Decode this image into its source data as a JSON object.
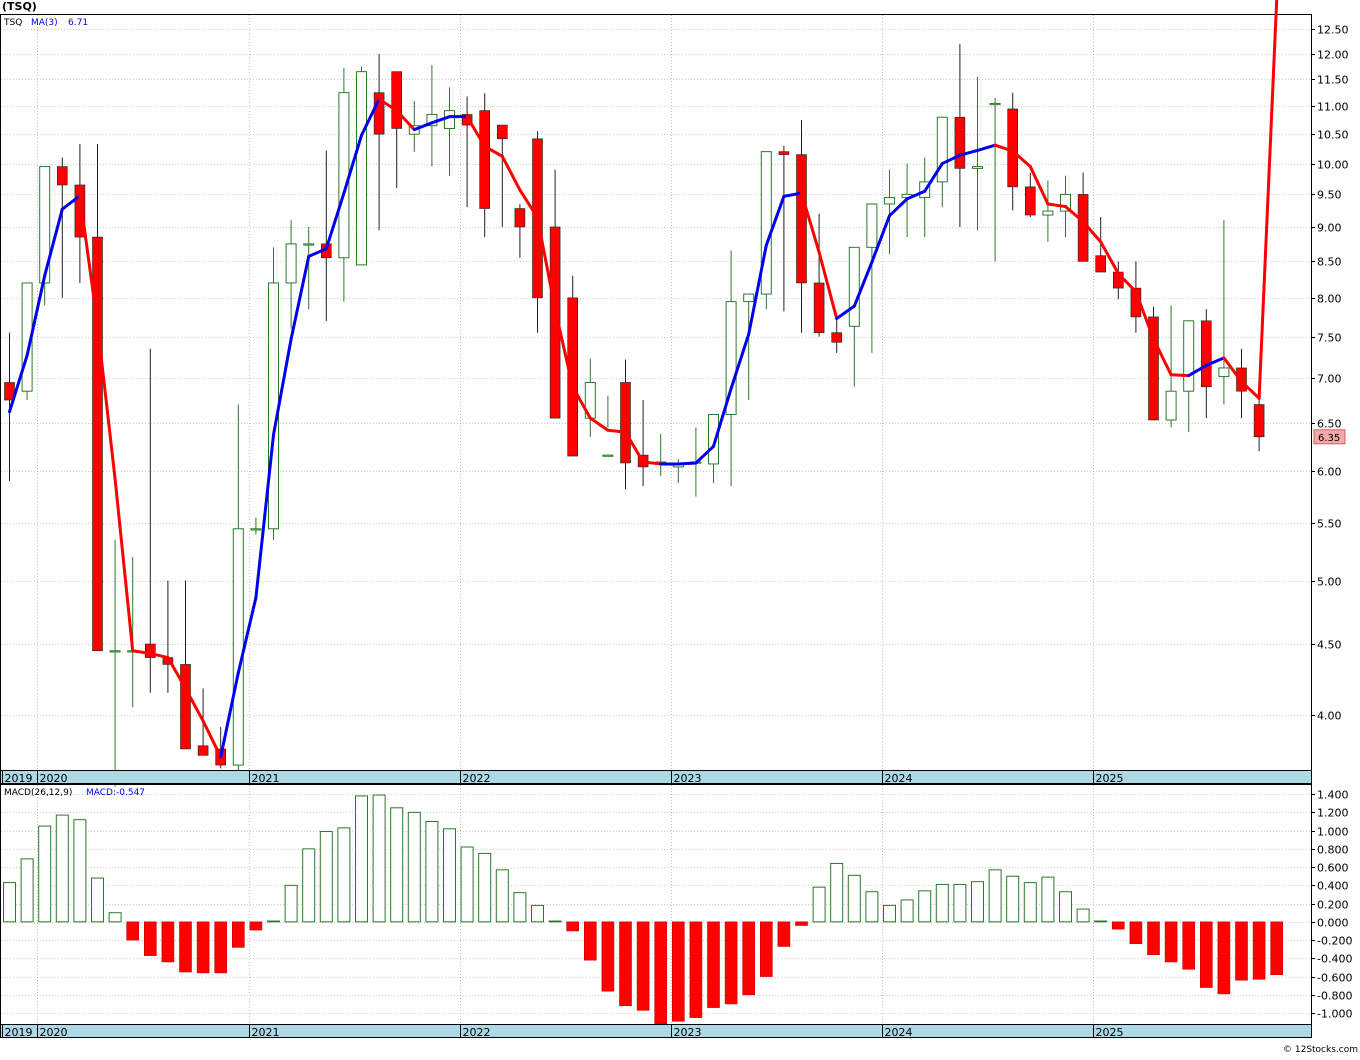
{
  "header": {
    "ticker": "(TSQ)",
    "ma_label": "TSQ",
    "ma_name": "MA(3)",
    "ma_value": "6.71",
    "macd_name": "MACD(26,12,9)",
    "macd_value": "MACD:-0.547",
    "last_price_label": "6.35",
    "watermark": "© 12Stocks.com"
  },
  "colors": {
    "up_candle": "#2a7a2a",
    "down_candle": "#ff0000",
    "ma_up": "#0000ee",
    "ma_down": "#ff0000",
    "axis_band": "#add8e6",
    "grid": "#999999"
  },
  "chart_data": [
    {
      "type": "candlestick",
      "interval": "monthly",
      "title": "(TSQ)",
      "scale": "log",
      "ylim": [
        3.65,
        12.8
      ],
      "y_ticks": [
        4.0,
        4.5,
        5.0,
        5.5,
        6.0,
        6.5,
        7.0,
        7.5,
        8.0,
        8.5,
        9.0,
        9.5,
        10.0,
        10.5,
        11.0,
        11.5,
        12.0,
        12.5
      ],
      "y_tick_labels": [
        "4.00",
        "4.50",
        "5.00",
        "5.50",
        "6.00",
        "6.50",
        "7.00",
        "7.50",
        "8.00",
        "8.50",
        "9.00",
        "9.50",
        "10.00",
        "10.50",
        "11.00",
        "11.50",
        "12.00",
        "12.50"
      ],
      "x_axis_labels": [
        "2019",
        "2020",
        "2021",
        "2022",
        "2023",
        "2024",
        "2025"
      ],
      "x_label_months": [
        "2019-11",
        "2020-01",
        "2021-01",
        "2022-01",
        "2023-01",
        "2024-01",
        "2025-01"
      ],
      "months": [
        "2019-11",
        "2019-12",
        "2020-01",
        "2020-02",
        "2020-03",
        "2020-04",
        "2020-05",
        "2020-06",
        "2020-07",
        "2020-08",
        "2020-09",
        "2020-10",
        "2020-11",
        "2020-12",
        "2021-01",
        "2021-02",
        "2021-03",
        "2021-04",
        "2021-05",
        "2021-06",
        "2021-07",
        "2021-08",
        "2021-09",
        "2021-10",
        "2021-11",
        "2021-12",
        "2022-01",
        "2022-02",
        "2022-03",
        "2022-04",
        "2022-05",
        "2022-06",
        "2022-07",
        "2022-08",
        "2022-09",
        "2022-10",
        "2022-11",
        "2022-12",
        "2023-01",
        "2023-02",
        "2023-03",
        "2023-04",
        "2023-05",
        "2023-06",
        "2023-07",
        "2023-08",
        "2023-09",
        "2023-10",
        "2023-11",
        "2023-12",
        "2024-01",
        "2024-02",
        "2024-03",
        "2024-04",
        "2024-05",
        "2024-06",
        "2024-07",
        "2024-08",
        "2024-09",
        "2024-10",
        "2024-11",
        "2024-12",
        "2025-01",
        "2025-02",
        "2025-03",
        "2025-04",
        "2025-05",
        "2025-06",
        "2025-07",
        "2025-08",
        "2025-09",
        "2025-10",
        "2025-11"
      ],
      "open": [
        6.95,
        6.85,
        8.2,
        9.95,
        9.65,
        8.85,
        4.45,
        4.45,
        4.5,
        4.4,
        4.35,
        3.8,
        3.78,
        3.68,
        5.45,
        5.45,
        8.2,
        8.75,
        8.75,
        8.55,
        8.45,
        11.25,
        11.65,
        10.5,
        10.65,
        10.6,
        10.85,
        10.92,
        10.66,
        9.28,
        10.42,
        9.0,
        8.0,
        6.55,
        6.15,
        6.95,
        6.16,
        6.08,
        6.04,
        6.09,
        6.07,
        6.59,
        7.95,
        8.05,
        10.2,
        10.15,
        8.2,
        7.55,
        7.63,
        8.7,
        9.35,
        9.45,
        9.45,
        9.7,
        10.8,
        9.92,
        11.05,
        10.95,
        9.62,
        9.18,
        9.24,
        9.5,
        8.58,
        8.35,
        8.13,
        7.75,
        6.53,
        6.85,
        7.7,
        7.02,
        7.12,
        6.7
      ],
      "high": [
        7.55,
        7.35,
        8.6,
        10.1,
        10.33,
        10.33,
        5.35,
        5.2,
        7.35,
        5.0,
        5.0,
        4.18,
        3.92,
        6.7,
        5.55,
        8.7,
        9.1,
        9.0,
        10.22,
        11.72,
        11.75,
        12.0,
        11.1,
        11.1,
        11.78,
        11.35,
        11.18,
        11.24,
        10.65,
        9.35,
        10.55,
        9.9,
        8.3,
        7.23,
        6.8,
        7.22,
        6.75,
        6.38,
        6.12,
        6.45,
        6.4,
        8.65,
        8.05,
        8.5,
        10.3,
        10.75,
        9.2,
        7.75,
        7.85,
        9.15,
        9.9,
        10.0,
        10.1,
        10.5,
        12.2,
        11.55,
        11.15,
        11.25,
        9.85,
        9.72,
        9.8,
        9.85,
        9.15,
        8.5,
        8.5,
        7.88,
        7.9,
        7.2,
        7.85,
        9.1,
        7.35,
        6.85
      ],
      "low": [
        5.9,
        6.75,
        7.9,
        8.0,
        8.2,
        4.45,
        3.55,
        4.05,
        4.15,
        4.15,
        3.85,
        3.78,
        3.66,
        3.65,
        5.4,
        5.35,
        7.6,
        7.85,
        7.7,
        7.95,
        8.95,
        8.95,
        9.6,
        10.2,
        9.95,
        9.8,
        9.3,
        8.85,
        9.0,
        8.55,
        7.55,
        6.55,
        6.25,
        6.35,
        6.45,
        5.82,
        5.85,
        5.95,
        5.88,
        5.75,
        5.88,
        5.85,
        6.75,
        7.85,
        7.82,
        7.55,
        7.5,
        7.3,
        6.9,
        7.3,
        8.6,
        8.85,
        8.85,
        9.3,
        9.0,
        8.95,
        8.5,
        9.25,
        9.15,
        8.78,
        8.85,
        8.7,
        8.35,
        7.98,
        7.55,
        6.95,
        6.45,
        6.4,
        6.55,
        6.7,
        6.55,
        6.2
      ],
      "close": [
        6.75,
        8.2,
        9.95,
        9.65,
        8.85,
        4.45,
        4.45,
        4.45,
        4.4,
        4.35,
        3.78,
        3.74,
        3.68,
        5.45,
        5.45,
        8.2,
        8.75,
        8.75,
        8.55,
        11.25,
        11.65,
        10.5,
        10.6,
        10.65,
        10.85,
        10.92,
        10.66,
        9.28,
        10.42,
        9.0,
        8.0,
        6.55,
        6.15,
        6.95,
        6.16,
        6.08,
        6.04,
        6.09,
        6.07,
        6.09,
        6.59,
        7.95,
        8.05,
        10.2,
        10.15,
        8.2,
        7.55,
        7.43,
        8.7,
        9.35,
        9.45,
        9.5,
        9.7,
        10.8,
        9.92,
        9.95,
        11.05,
        9.62,
        9.18,
        9.24,
        9.5,
        8.5,
        8.35,
        8.13,
        7.75,
        6.53,
        6.85,
        7.7,
        6.9,
        7.12,
        6.85,
        6.35
      ],
      "ma3": [
        6.62,
        7.27,
        8.3,
        9.27,
        9.48,
        7.65,
        5.92,
        4.45,
        4.43,
        4.4,
        4.18,
        3.96,
        3.73,
        4.29,
        4.86,
        6.37,
        7.47,
        8.57,
        8.68,
        9.52,
        10.48,
        11.13,
        10.92,
        10.58,
        10.7,
        10.81,
        10.81,
        10.29,
        10.12,
        9.57,
        9.14,
        7.85,
        6.9,
        6.55,
        6.42,
        6.4,
        6.09,
        6.07,
        6.07,
        6.08,
        6.25,
        6.88,
        7.53,
        8.73,
        9.47,
        9.52,
        8.63,
        7.73,
        7.89,
        8.49,
        9.17,
        9.43,
        9.55,
        10.0,
        10.14,
        10.22,
        10.31,
        10.21,
        9.95,
        9.35,
        9.31,
        9.08,
        8.78,
        8.33,
        8.08,
        7.47,
        7.04,
        7.03,
        7.15,
        7.24,
        6.96,
        6.77
      ],
      "last": 6.35
    },
    {
      "type": "bar",
      "title": "MACD(26,12,9)",
      "ylim": [
        -1.12,
        1.5
      ],
      "y_ticks": [
        -1.0,
        -0.8,
        -0.6,
        -0.4,
        -0.2,
        0.0,
        0.2,
        0.4,
        0.6,
        0.8,
        1.0,
        1.2,
        1.4
      ],
      "y_tick_labels": [
        "-1.000",
        "-0.800",
        "-0.600",
        "-0.400",
        "-0.200",
        "0.000",
        "0.200",
        "0.400",
        "0.600",
        "0.800",
        "1.000",
        "1.200",
        "1.400"
      ],
      "x_axis_labels": [
        "2019",
        "2020",
        "2021",
        "2022",
        "2023",
        "2024",
        "2025"
      ],
      "values": [
        0.43,
        0.69,
        1.05,
        1.17,
        1.12,
        0.48,
        0.1,
        -0.2,
        -0.37,
        -0.44,
        -0.55,
        -0.56,
        -0.56,
        -0.28,
        -0.09,
        0.0,
        0.4,
        0.8,
        0.99,
        1.03,
        1.38,
        1.39,
        1.25,
        1.2,
        1.1,
        1.02,
        0.82,
        0.75,
        0.57,
        0.32,
        0.18,
        0.0,
        -0.1,
        -0.42,
        -0.76,
        -0.92,
        -0.97,
        -1.12,
        -1.09,
        -1.05,
        -0.94,
        -0.9,
        -0.8,
        -0.6,
        -0.27,
        -0.04,
        0.38,
        0.64,
        0.51,
        0.33,
        0.18,
        0.24,
        0.34,
        0.41,
        0.41,
        0.44,
        0.57,
        0.5,
        0.43,
        0.49,
        0.33,
        0.14,
        0.0,
        -0.08,
        -0.24,
        -0.36,
        -0.44,
        -0.52,
        -0.72,
        -0.79,
        -0.64,
        -0.63,
        -0.58,
        -0.56
      ]
    }
  ]
}
